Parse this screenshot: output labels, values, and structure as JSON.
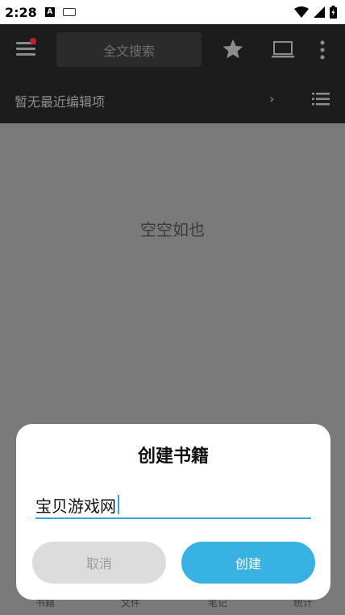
{
  "status_bar": {
    "time": "2:28",
    "a_badge": "A"
  },
  "toolbar": {
    "search_placeholder": "全文搜索"
  },
  "recent": {
    "label": "暂无最近编辑项",
    "chevron": "›"
  },
  "main": {
    "empty_text": "空空如也"
  },
  "bottom_nav": {
    "tabs": [
      "书籍",
      "文件",
      "笔记",
      "统计"
    ]
  },
  "dialog": {
    "title": "创建书籍",
    "input_value": "宝贝游戏网",
    "cancel_label": "取消",
    "create_label": "创建"
  },
  "colors": {
    "toolbar_bg": "#1c1c1c",
    "accent": "#38b2e3",
    "notification_dot": "#c0202a"
  }
}
